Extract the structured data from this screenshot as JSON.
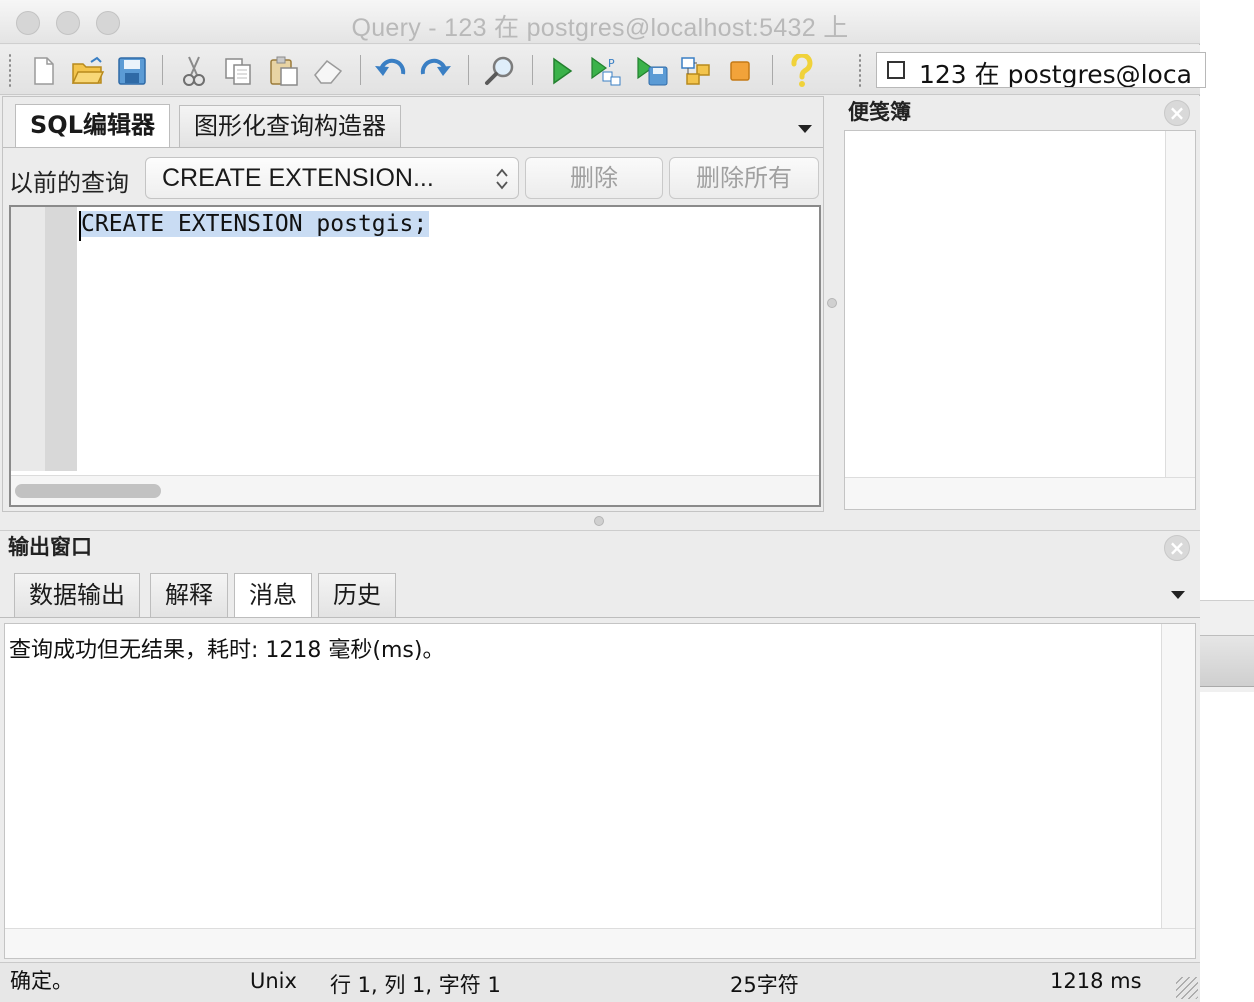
{
  "window": {
    "title": "Query - 123 在  postgres@localhost:5432 上"
  },
  "toolbar": {
    "buttons": [
      {
        "name": "new-file-icon"
      },
      {
        "name": "open-folder-icon"
      },
      {
        "name": "save-icon"
      },
      {
        "name": "cut-icon"
      },
      {
        "name": "copy-icon"
      },
      {
        "name": "paste-icon"
      },
      {
        "name": "eraser-icon"
      },
      {
        "name": "undo-icon"
      },
      {
        "name": "redo-icon"
      },
      {
        "name": "find-icon"
      },
      {
        "name": "execute-icon"
      },
      {
        "name": "explain-icon"
      },
      {
        "name": "execute-to-file-icon"
      },
      {
        "name": "query-builder-icon"
      },
      {
        "name": "stop-icon"
      },
      {
        "name": "help-icon"
      }
    ],
    "connection": "123 在  postgres@loca"
  },
  "editor": {
    "tabs": [
      {
        "label": "SQL编辑器",
        "active": true
      },
      {
        "label": "图形化查询构造器",
        "active": false
      }
    ],
    "previous_label": "以前的查询",
    "previous_value": "CREATE EXTENSION...",
    "delete_label": "删除",
    "delete_all_label": "删除所有",
    "sql": "CREATE EXTENSION postgis;"
  },
  "notes": {
    "title": "便笺簿"
  },
  "output": {
    "title": "输出窗口",
    "tabs": [
      {
        "label": "数据输出",
        "active": false
      },
      {
        "label": "解释",
        "active": false
      },
      {
        "label": "消息",
        "active": true
      },
      {
        "label": "历史",
        "active": false
      }
    ],
    "message": "查询成功但无结果，耗时: 1218 毫秒(ms)。"
  },
  "status": {
    "state": "确定。",
    "line_ending": "Unix",
    "position": "行 1, 列 1, 字符 1",
    "char_count": "25字符",
    "elapsed": "1218 ms"
  },
  "colors": {
    "selection": "#c9dcf3",
    "run_green": "#3bb24a",
    "stop_orange": "#f2a33a",
    "help_yellow": "#f0d23a",
    "toolbar_blue": "#3a7fc4"
  }
}
